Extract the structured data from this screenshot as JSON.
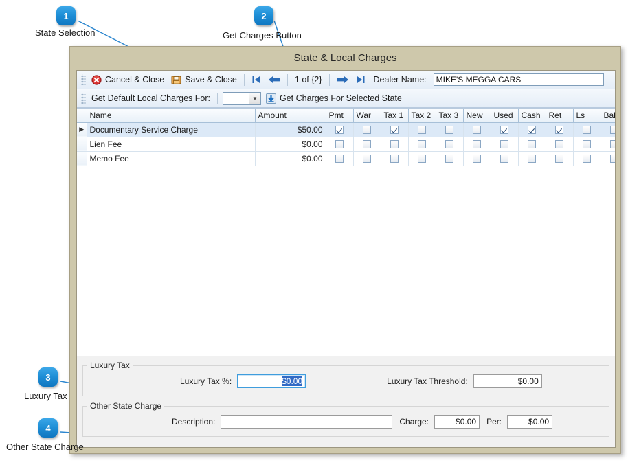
{
  "annotations": [
    {
      "number": "1",
      "label": "State Selection"
    },
    {
      "number": "2",
      "label": "Get Charges Button"
    },
    {
      "number": "3",
      "label": "Luxury Tax"
    },
    {
      "number": "4",
      "label": "Other State Charge"
    }
  ],
  "window": {
    "title": "State & Local Charges"
  },
  "toolbar_top": {
    "cancel_close": "Cancel & Close",
    "save_close": "Save & Close",
    "first_icon": "first-record-icon",
    "prev_icon": "previous-record-icon",
    "record_position": "1 of {2}",
    "next_icon": "next-record-icon",
    "last_icon": "last-record-icon",
    "dealer_name_label": "Dealer Name:",
    "dealer_name_value": "MIKE'S MEGGA CARS"
  },
  "toolbar_second": {
    "get_default_label": "Get Default Local Charges For:",
    "state_combo_value": "",
    "get_charges_button": "Get Charges For Selected State"
  },
  "grid": {
    "columns": [
      "Name",
      "Amount",
      "Pmt",
      "War",
      "Tax 1",
      "Tax 2",
      "Tax 3",
      "New",
      "Used",
      "Cash",
      "Ret",
      "Ls",
      "Bal"
    ],
    "rows": [
      {
        "selected": true,
        "indicator": "▶",
        "name": "Documentary Service Charge",
        "amount": "$50.00",
        "checks": [
          true,
          false,
          true,
          false,
          false,
          false,
          true,
          true,
          true,
          false,
          false
        ]
      },
      {
        "selected": false,
        "indicator": "",
        "name": "Lien Fee",
        "amount": "$0.00",
        "checks": [
          false,
          false,
          false,
          false,
          false,
          false,
          false,
          false,
          false,
          false,
          false
        ]
      },
      {
        "selected": false,
        "indicator": "",
        "name": "Memo Fee",
        "amount": "$0.00",
        "checks": [
          false,
          false,
          false,
          false,
          false,
          false,
          false,
          false,
          false,
          false,
          false
        ]
      }
    ]
  },
  "luxury_tax": {
    "group_label": "Luxury Tax",
    "percent_label": "Luxury Tax %:",
    "percent_value": "$0.00",
    "threshold_label": "Luxury Tax Threshold:",
    "threshold_value": "$0.00"
  },
  "other_state_charge": {
    "group_label": "Other State Charge",
    "description_label": "Description:",
    "description_value": "",
    "charge_label": "Charge:",
    "charge_value": "$0.00",
    "per_label": "Per:",
    "per_value": "$0.00"
  },
  "colors": {
    "accent": "#1e8ed6",
    "window_frame": "#cec8ab",
    "toolbar": "#e4edf7",
    "row_selected": "#dce9f7",
    "selection_highlight": "#316ac5"
  }
}
